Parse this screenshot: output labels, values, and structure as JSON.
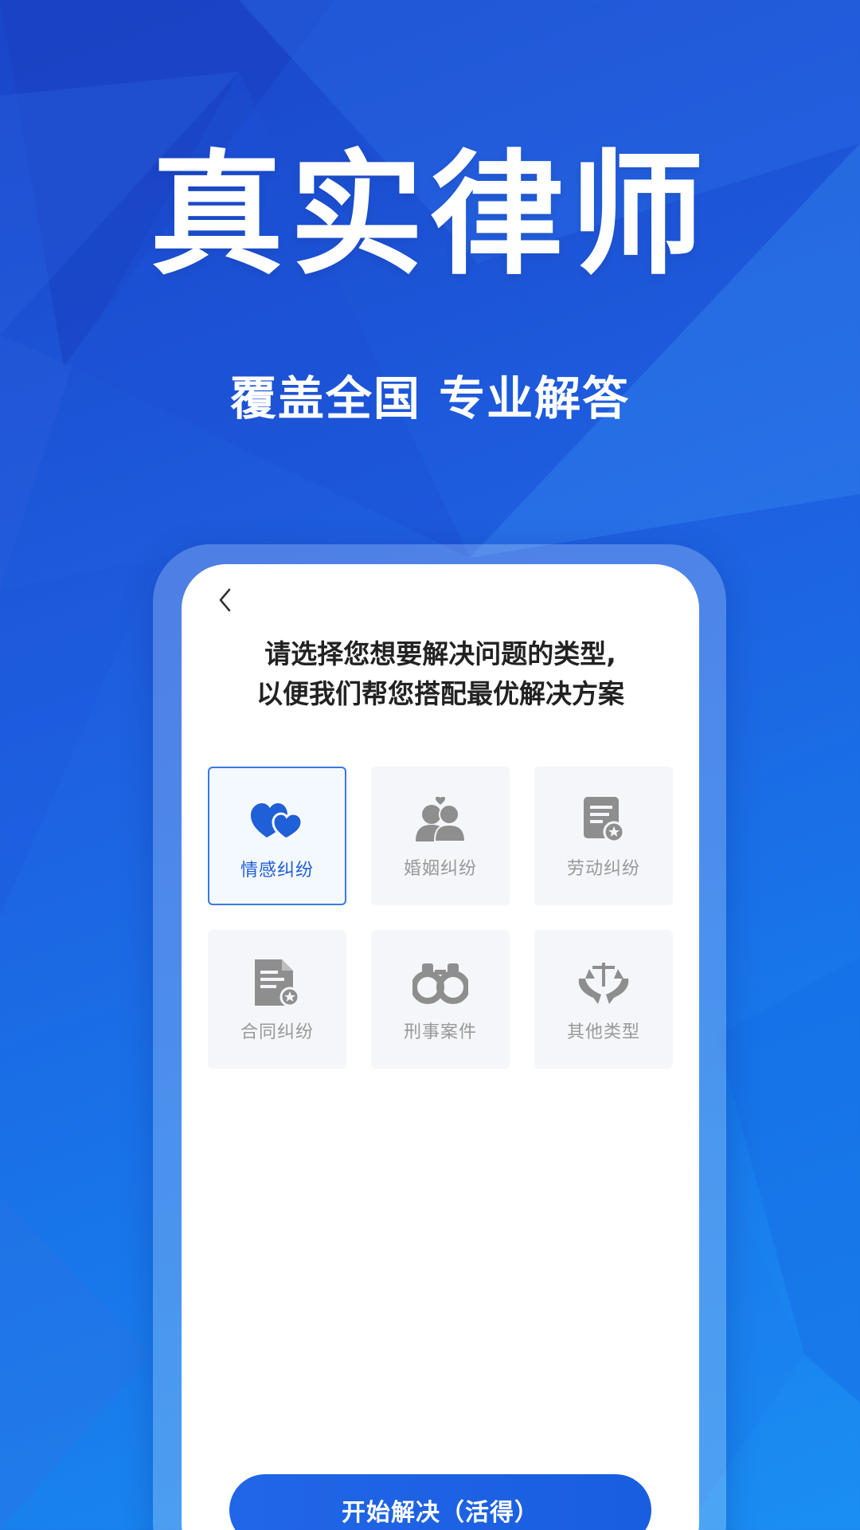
{
  "hero": {
    "title": "真实律师",
    "subtitle": "覆盖全国 专业解答"
  },
  "screen": {
    "back_icon": "chevron-left-icon",
    "prompt_line1": "请选择您想要解决问题的类型,",
    "prompt_line2": "以便我们帮您搭配最优解决方案",
    "categories": [
      {
        "label": "情感纠纷",
        "icon": "hearts-icon",
        "selected": true
      },
      {
        "label": "婚姻纠纷",
        "icon": "couple-icon",
        "selected": false
      },
      {
        "label": "劳动纠纷",
        "icon": "document-badge-icon",
        "selected": false
      },
      {
        "label": "合同纠纷",
        "icon": "contract-icon",
        "selected": false
      },
      {
        "label": "刑事案件",
        "icon": "handcuffs-icon",
        "selected": false
      },
      {
        "label": "其他类型",
        "icon": "scales-icon",
        "selected": false
      }
    ],
    "start_button": "开始解决（活得）"
  },
  "colors": {
    "accent": "#1f5fd8",
    "icon_gray": "#8e8e8e",
    "card_bg": "#f5f6f9"
  }
}
